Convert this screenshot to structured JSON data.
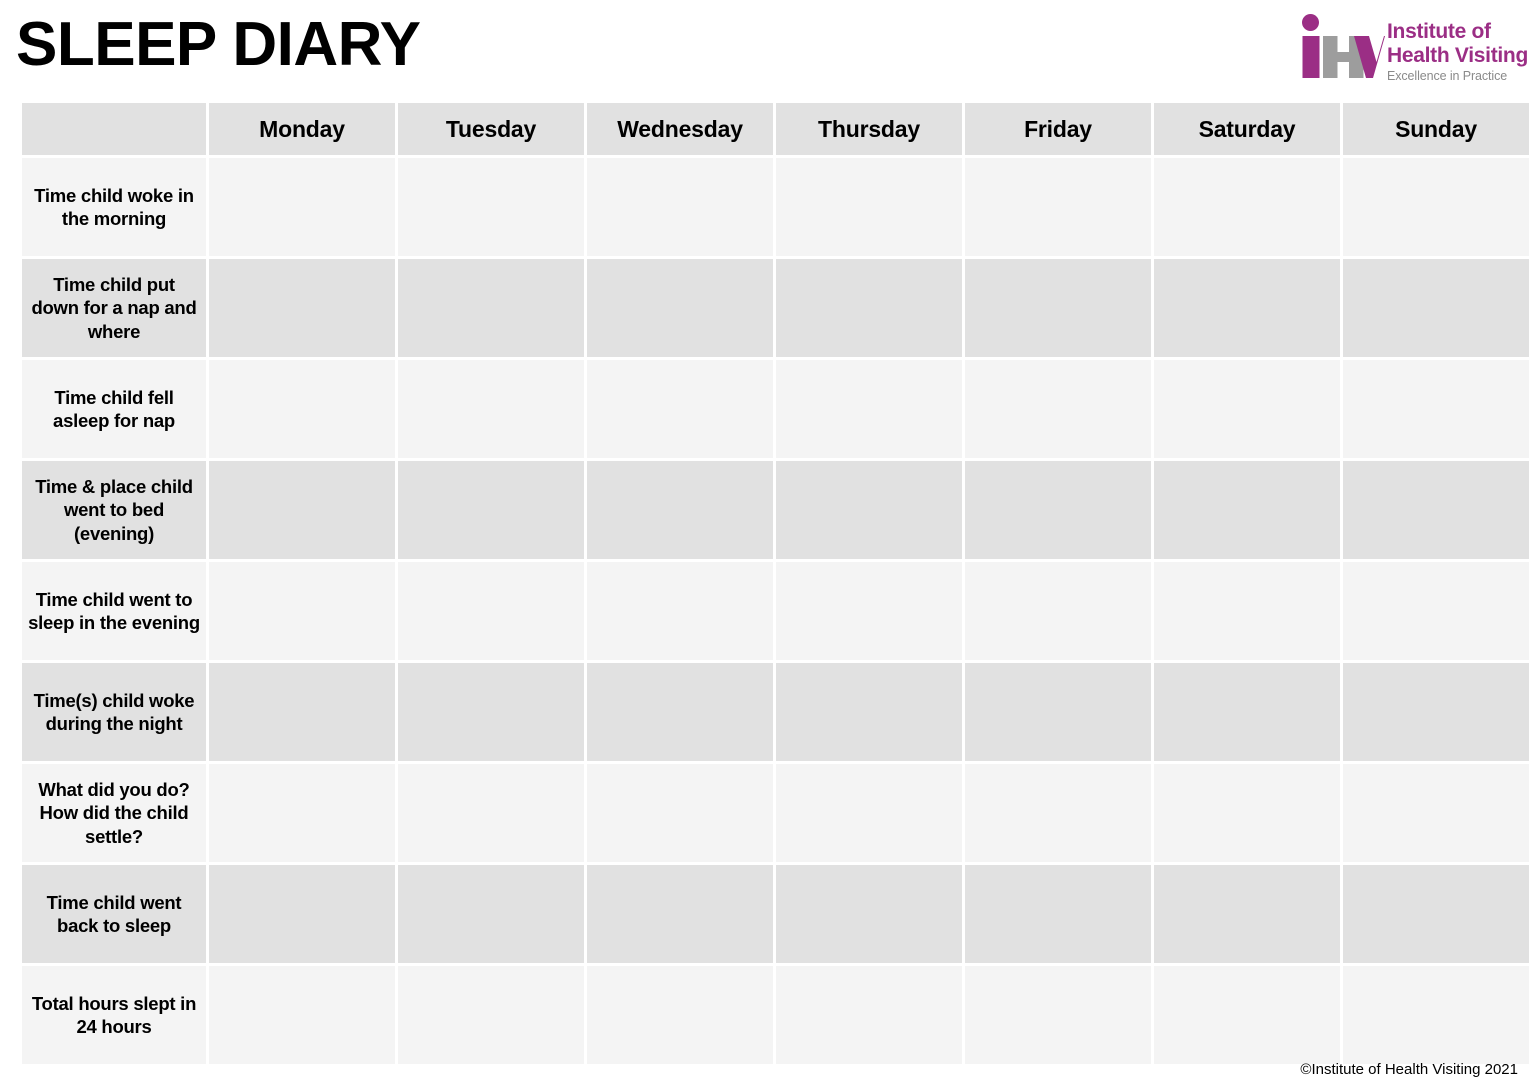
{
  "document": {
    "title": "SLEEP DIARY",
    "footer_copyright": "©Institute of Health Visiting 2021"
  },
  "logo": {
    "mark_letters": "iHV",
    "line1": "Institute of",
    "line2": "Health Visiting",
    "line3": "Excellence in Practice",
    "magenta": "#9b2e85",
    "grey": "#9d9d9d"
  },
  "table": {
    "corner_header": "",
    "day_headers": [
      "Monday",
      "Tuesday",
      "Wednesday",
      "Thursday",
      "Friday",
      "Saturday",
      "Sunday"
    ],
    "rows": [
      {
        "label": "Time child woke in the morning"
      },
      {
        "label": "Time child put down for a nap and where"
      },
      {
        "label": "Time child fell asleep for nap"
      },
      {
        "label": "Time & place child went to bed (evening)"
      },
      {
        "label": "Time child went to sleep in the evening"
      },
      {
        "label": "Time(s) child woke during the night"
      },
      {
        "label": "What did you do? How did the child settle?"
      },
      {
        "label": "Time child went back to sleep"
      },
      {
        "label": "Total hours slept in 24 hours"
      }
    ],
    "cell_values": [
      [
        "",
        "",
        "",
        "",
        "",
        "",
        ""
      ],
      [
        "",
        "",
        "",
        "",
        "",
        "",
        ""
      ],
      [
        "",
        "",
        "",
        "",
        "",
        "",
        ""
      ],
      [
        "",
        "",
        "",
        "",
        "",
        "",
        ""
      ],
      [
        "",
        "",
        "",
        "",
        "",
        "",
        ""
      ],
      [
        "",
        "",
        "",
        "",
        "",
        "",
        ""
      ],
      [
        "",
        "",
        "",
        "",
        "",
        "",
        ""
      ],
      [
        "",
        "",
        "",
        "",
        "",
        "",
        ""
      ],
      [
        "",
        "",
        "",
        "",
        "",
        "",
        ""
      ]
    ],
    "colors": {
      "header_bg": "#e1e1e1",
      "row_light_bg": "#f4f4f4",
      "row_dark_bg": "#e1e1e1",
      "gap": "#ffffff"
    }
  }
}
